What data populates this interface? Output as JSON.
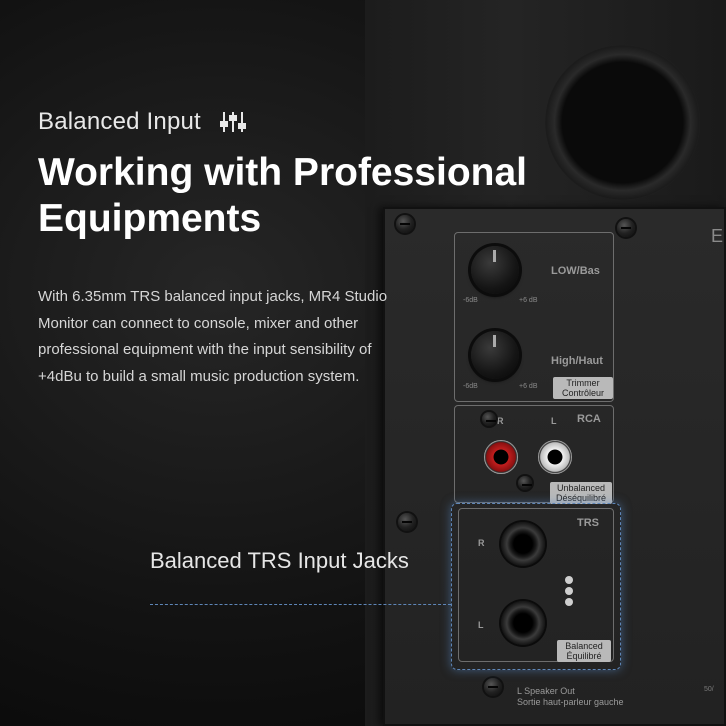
{
  "heading": {
    "eyebrow": "Balanced Input",
    "eyebrow_icon": "sliders-icon",
    "title_line1": "Working with Professional",
    "title_line2": "Equipments"
  },
  "description": "With 6.35mm TRS balanced input jacks, MR4 Studio Monitor can connect to console, mixer and other professional equipment with the input sensibility of +4dBu to build a small music production system.",
  "callout": "Balanced TRS Input Jacks",
  "panel": {
    "edge_letter": "E",
    "trimmer": {
      "low_label": "LOW/Bas",
      "high_label": "High/Haut",
      "min_label": "-6dB",
      "max_label": "+6 dB",
      "tag_line1": "Trimmer",
      "tag_line2": "Contrôleur"
    },
    "rca": {
      "title": "RCA",
      "r": "R",
      "l": "L",
      "tag_line1": "Unbalanced",
      "tag_line2": "Déséquilibré"
    },
    "trs": {
      "title": "TRS",
      "r": "R",
      "l": "L",
      "tag_line1": "Balanced",
      "tag_line2": "Équilibré"
    },
    "speaker_out_line1": "L Speaker Out",
    "speaker_out_line2": "Sortie haut-parleur gauche",
    "edge_text": "50/"
  },
  "colors": {
    "accent_dashed": "#5e86b8",
    "text_primary": "#ffffff"
  }
}
